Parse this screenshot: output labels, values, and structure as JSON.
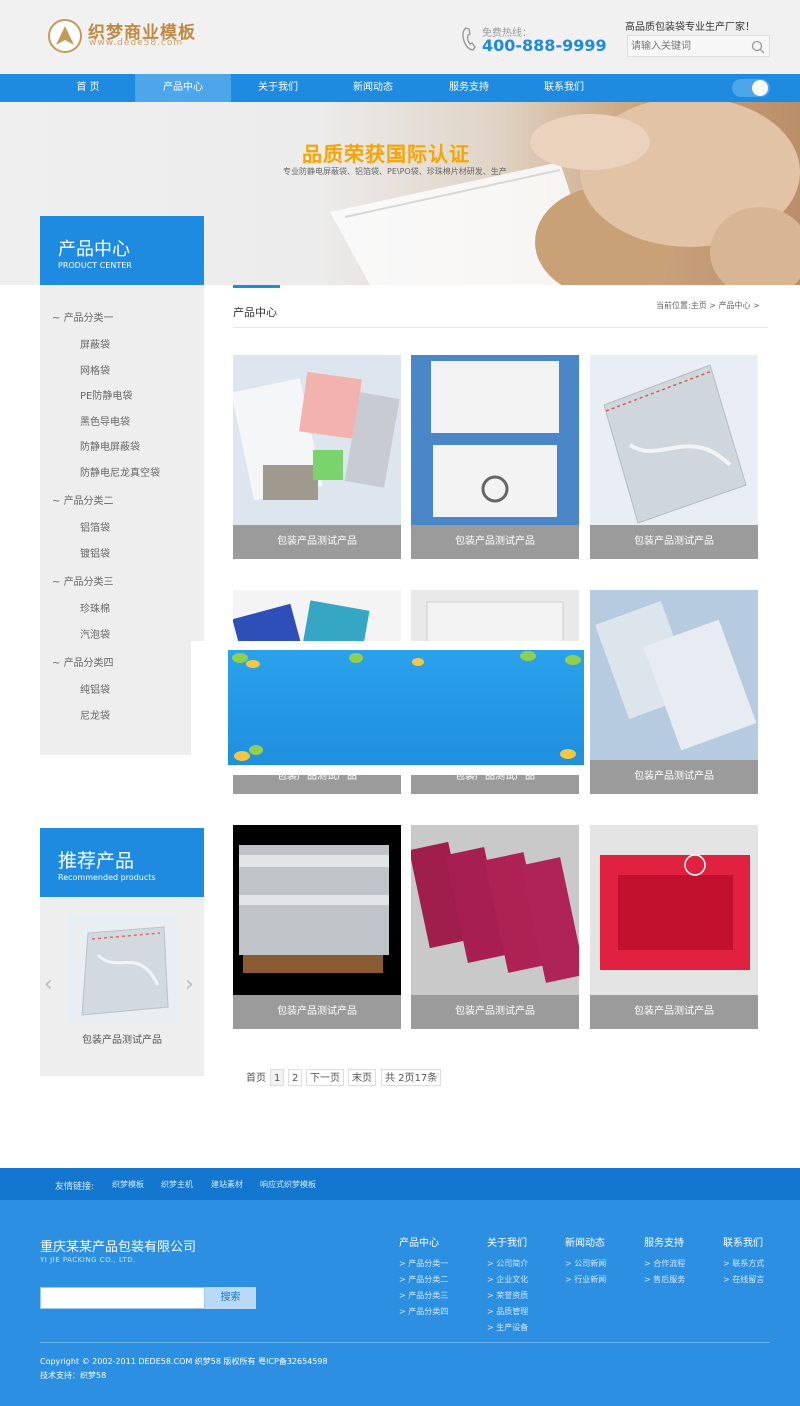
{
  "header": {
    "logo_title": "织梦商业模板",
    "logo_url": "www.dede58.com",
    "hotline_label": "免费热线：",
    "hotline_number": "400-888-9999",
    "slogan": "高品质包装袋专业生产厂家！",
    "search_placeholder": "请输入关键词"
  },
  "nav": {
    "items": [
      "首 页",
      "产品中心",
      "关于我们",
      "新闻动态",
      "服务支持",
      "联系我们"
    ],
    "active_index": 1
  },
  "banner": {
    "title": "品质荣获国际认证",
    "subtitle": "专业防静电屏蔽袋、铝箔袋、PE\\PO袋、珍珠棉片材研发、生产"
  },
  "sidebar": {
    "title": "产品中心",
    "subtitle": "PRODUCT CENTER",
    "groups": [
      {
        "label": "产品分类一",
        "items": [
          "屏蔽袋",
          "网格袋",
          "PE防静电袋",
          "黑色导电袋",
          "防静电屏蔽袋",
          "防静电尼龙真空袋"
        ]
      },
      {
        "label": "产品分类二",
        "items": [
          "铝箔袋",
          "镀铝袋"
        ]
      },
      {
        "label": "产品分类三",
        "items": [
          "珍珠棉",
          "汽泡袋"
        ]
      },
      {
        "label": "产品分类四",
        "items": [
          "纯铝袋",
          "尼龙袋"
        ]
      }
    ]
  },
  "recommend": {
    "title": "推荐产品",
    "subtitle": "Recommended products",
    "caption": "包装产品测试产品"
  },
  "main": {
    "title": "产品中心",
    "breadcrumb": "当前位置:主页 > 产品中心 >",
    "products": [
      {
        "caption": "包装产品测试产品"
      },
      {
        "caption": "包装产品测试产品"
      },
      {
        "caption": "包装产品测试产品"
      },
      {
        "caption": "包装产品测试产品"
      },
      {
        "caption": "包装产品测试产品"
      },
      {
        "caption": "包装产品测试产品"
      },
      {
        "caption": "包装产品测试产品"
      },
      {
        "caption": "包装产品测试产品"
      },
      {
        "caption": "包装产品测试产品"
      }
    ]
  },
  "pagination": {
    "first": "首页",
    "page1": "1",
    "page2": "2",
    "next": "下一页",
    "last": "末页",
    "info": "共 2页17条"
  },
  "footer": {
    "links_label": "友情链接:",
    "links": [
      "织梦模板",
      "织梦主机",
      "建站素材",
      "响应式织梦模板"
    ],
    "company": "重庆某某产品包装有限公司",
    "company_en": "YI JIE PACKING CO., LTD.",
    "search_button": "搜索",
    "columns": [
      {
        "title": "产品中心",
        "items": [
          "产品分类一",
          "产品分类二",
          "产品分类三",
          "产品分类四"
        ]
      },
      {
        "title": "关于我们",
        "items": [
          "公司简介",
          "企业文化",
          "荣誉资质",
          "品质管理",
          "生产设备"
        ]
      },
      {
        "title": "新闻动态",
        "items": [
          "公司新闻",
          "行业新闻"
        ]
      },
      {
        "title": "服务支持",
        "items": [
          "合作流程",
          "售后服务"
        ]
      },
      {
        "title": "联系我们",
        "items": [
          "联系方式",
          "在线留言"
        ]
      }
    ],
    "copyright": "Copyright © 2002-2011 DEDE58.COM 织梦58 版权所有 粤ICP备32654598",
    "support": "技术支持：织梦58"
  },
  "colors": {
    "brand_blue": "#1e8ae0",
    "footer_blue": "#2c8fe2",
    "banner_title": "#f5a400",
    "caption_gray": "#9b9b9b"
  }
}
